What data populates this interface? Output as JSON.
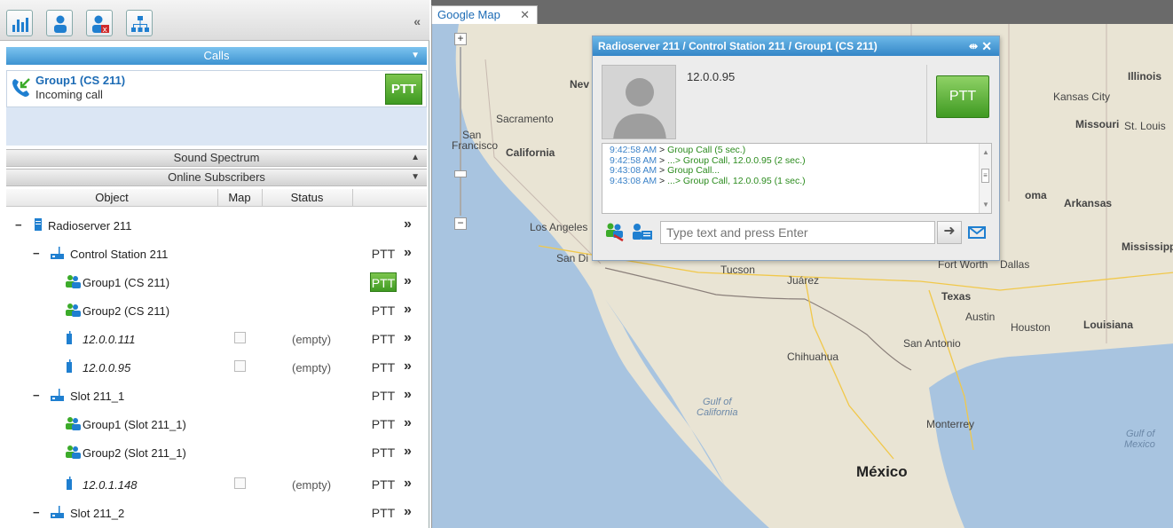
{
  "toolbar": {
    "buttons": [
      "equalizer-icon",
      "user-icon",
      "user-remove-icon",
      "hierarchy-icon"
    ],
    "collapse": "«"
  },
  "calls": {
    "header": "Calls",
    "item": {
      "title": "Group1 (CS 211)",
      "status": "Incoming call",
      "ptt": "PTT"
    }
  },
  "sound_spectrum": {
    "header": "Sound Spectrum"
  },
  "online_subscribers": {
    "header": "Online Subscribers",
    "columns": {
      "object": "Object",
      "map": "Map",
      "status": "Status"
    },
    "rows": [
      {
        "label": "Radioserver 211",
        "expand": "−",
        "ptt": "",
        "more": "»"
      },
      {
        "label": "Control Station 211",
        "expand": "−",
        "ptt": "PTT",
        "more": "»"
      },
      {
        "label": "Group1 (CS 211)",
        "ptt": "PTT",
        "more": "»"
      },
      {
        "label": "Group2 (CS 211)",
        "ptt": "PTT",
        "more": "»"
      },
      {
        "label": "12.0.0.111",
        "status": "(empty)",
        "ptt": "PTT",
        "more": "»"
      },
      {
        "label": "12.0.0.95",
        "status": "(empty)",
        "ptt": "PTT",
        "more": "»"
      },
      {
        "label": "Slot 211_1",
        "expand": "−",
        "ptt": "PTT",
        "more": "»"
      },
      {
        "label": "Group1 (Slot 211_1)",
        "ptt": "PTT",
        "more": "»"
      },
      {
        "label": "Group2 (Slot 211_1)",
        "ptt": "PTT",
        "more": "»"
      },
      {
        "label": "12.0.1.148",
        "status": "(empty)",
        "ptt": "PTT",
        "more": "»"
      },
      {
        "label": "Slot 211_2",
        "expand": "−",
        "ptt": "PTT",
        "more": "»"
      }
    ]
  },
  "map_tab": {
    "label": "Google Map",
    "close": "✕"
  },
  "map": {
    "zoom_in": "+",
    "zoom_out": "−",
    "labels": {
      "illinois": "Illinois",
      "kansas_city": "Kansas City",
      "missouri": "Missouri",
      "st_louis": "St. Louis",
      "nev": "Nev",
      "sacramento": "Sacramento",
      "san_francisco_1": "San",
      "san_francisco_2": "Francisco",
      "california": "California",
      "oma": "oma",
      "arkansas": "Arkansas",
      "los_angeles": "Los Angeles",
      "san_di": "San Di",
      "mississipp": "Mississipp",
      "tucson": "Tucson",
      "juarez": "Juárez",
      "fort_worth": "Fort Worth",
      "dallas": "Dallas",
      "texas": "Texas",
      "austin": "Austin",
      "houston": "Houston",
      "louisiana": "Louisiana",
      "san_antonio": "San Antonio",
      "chihuahua": "Chihuahua",
      "gulf_california_1": "Gulf of",
      "gulf_california_2": "California",
      "monterrey": "Monterrey",
      "gulf_mexico_1": "Gulf of",
      "gulf_mexico_2": "Mexico",
      "mexico": "México"
    }
  },
  "popup": {
    "title": "Radioserver 211 / Control Station 211 / Group1 (CS 211)",
    "pin": "⇹",
    "close": "✕",
    "ip": "12.0.0.95",
    "ptt": "PTT",
    "log": [
      {
        "time": "9:42:58 AM",
        "msg": "Group Call (5 sec.)"
      },
      {
        "time": "9:42:58 AM",
        "msg": "...> Group Call, 12.0.0.95 (2 sec.)"
      },
      {
        "time": "9:43:08 AM",
        "msg": "Group Call..."
      },
      {
        "time": "9:43:08 AM",
        "msg": "...> Group Call, 12.0.0.95 (1 sec.)"
      }
    ],
    "log_sep": " > ",
    "input_placeholder": "Type text and press Enter",
    "send": "➜"
  },
  "colors": {
    "accent": "#3d93d1",
    "ptt_green": "#3f9a22",
    "log_time": "#3c83c9",
    "log_msg": "#2b8b1d"
  }
}
